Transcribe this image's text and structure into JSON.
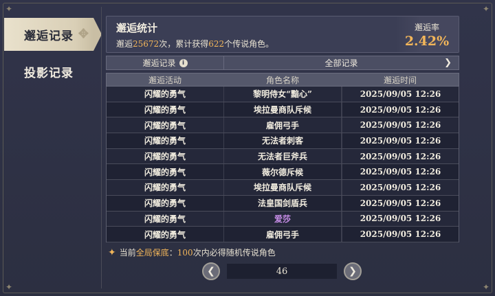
{
  "sidebar": {
    "tabs": [
      {
        "label": "邂逅记录",
        "active": true
      },
      {
        "label": "投影记录",
        "active": false
      }
    ]
  },
  "stats": {
    "title": "邂逅统计",
    "line_prefix": "邂逅",
    "total_pulls": "25672",
    "line_mid": "次，累计获得",
    "legendary_count": "622",
    "line_suffix": "个传说角色。",
    "rate_label": "邂逅率",
    "rate_value": "2.42%"
  },
  "filter": {
    "label": "邂逅记录",
    "selected": "全部记录"
  },
  "table": {
    "headers": [
      "邂逅活动",
      "角色名称",
      "邂逅时间"
    ],
    "rows": [
      [
        "闪耀的勇气",
        "黎明侍女“黯心”",
        "2025/09/05 12:26"
      ],
      [
        "闪耀的勇气",
        "埃拉曼商队斥候",
        "2025/09/05 12:26"
      ],
      [
        "闪耀的勇气",
        "雇佣弓手",
        "2025/09/05 12:26"
      ],
      [
        "闪耀的勇气",
        "无法者刺客",
        "2025/09/05 12:26"
      ],
      [
        "闪耀的勇气",
        "无法者巨斧兵",
        "2025/09/05 12:26"
      ],
      [
        "闪耀的勇气",
        "薇尔德斥候",
        "2025/09/05 12:26"
      ],
      [
        "闪耀的勇气",
        "埃拉曼商队斥候",
        "2025/09/05 12:26"
      ],
      [
        "闪耀的勇气",
        "法皇国剑盾兵",
        "2025/09/05 12:26"
      ],
      [
        "闪耀的勇气",
        "爱莎",
        "2025/09/05 12:26"
      ],
      [
        "闪耀的勇气",
        "雇佣弓手",
        "2025/09/05 12:26"
      ]
    ],
    "highlight_row_index": 8,
    "highlight_color": "#c88ee8"
  },
  "pity": {
    "prefix": "当前",
    "scope": "全局保底",
    "colon": "：",
    "count": "100",
    "suffix": "次内必得随机传说角色"
  },
  "pagination": {
    "page": "46",
    "prev_icon": "chevron-left-icon",
    "next_icon": "chevron-right-icon"
  },
  "colors": {
    "accent": "#f2b65a",
    "background": "#2c2f41"
  }
}
